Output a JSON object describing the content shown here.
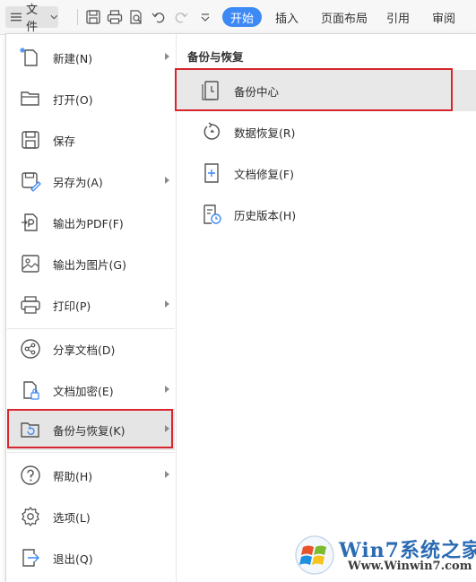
{
  "toolbar": {
    "file_label": "文件",
    "tabs": [
      {
        "label": "开始"
      },
      {
        "label": "插入"
      },
      {
        "label": "页面布局"
      },
      {
        "label": "引用"
      },
      {
        "label": "审阅"
      }
    ]
  },
  "menu": {
    "items": [
      {
        "label": "新建(N)",
        "icon": "new-file-icon",
        "has_submenu": true
      },
      {
        "label": "打开(O)",
        "icon": "folder-icon",
        "has_submenu": false
      },
      {
        "label": "保存",
        "icon": "save-icon",
        "has_submenu": false
      },
      {
        "label": "另存为(A)",
        "icon": "save-as-icon",
        "has_submenu": true
      },
      {
        "label": "输出为PDF(F)",
        "icon": "pdf-icon",
        "has_submenu": false
      },
      {
        "label": "输出为图片(G)",
        "icon": "image-icon",
        "has_submenu": false
      },
      {
        "label": "打印(P)",
        "icon": "printer-icon",
        "has_submenu": true
      },
      {
        "label": "分享文档(D)",
        "icon": "share-icon",
        "has_submenu": false
      },
      {
        "label": "文档加密(E)",
        "icon": "encrypt-icon",
        "has_submenu": true
      },
      {
        "label": "备份与恢复(K)",
        "icon": "backup-icon",
        "has_submenu": true,
        "selected": true
      },
      {
        "label": "帮助(H)",
        "icon": "help-icon",
        "has_submenu": true
      },
      {
        "label": "选项(L)",
        "icon": "gear-icon",
        "has_submenu": false
      },
      {
        "label": "退出(Q)",
        "icon": "exit-icon",
        "has_submenu": false
      }
    ]
  },
  "submenu": {
    "title": "备份与恢复",
    "items": [
      {
        "label": "备份中心",
        "icon": "backup-center-icon",
        "selected": true
      },
      {
        "label": "数据恢复(R)",
        "icon": "data-recovery-icon"
      },
      {
        "label": "文档修复(F)",
        "icon": "doc-repair-icon"
      },
      {
        "label": "历史版本(H)",
        "icon": "history-version-icon"
      }
    ]
  },
  "watermark": {
    "title": "Win7系统之家",
    "url": "Www.Winwin7.com"
  },
  "colors": {
    "accent": "#3d8af5",
    "highlight_border": "#d7262e",
    "selected_bg": "#e5e5e5"
  }
}
